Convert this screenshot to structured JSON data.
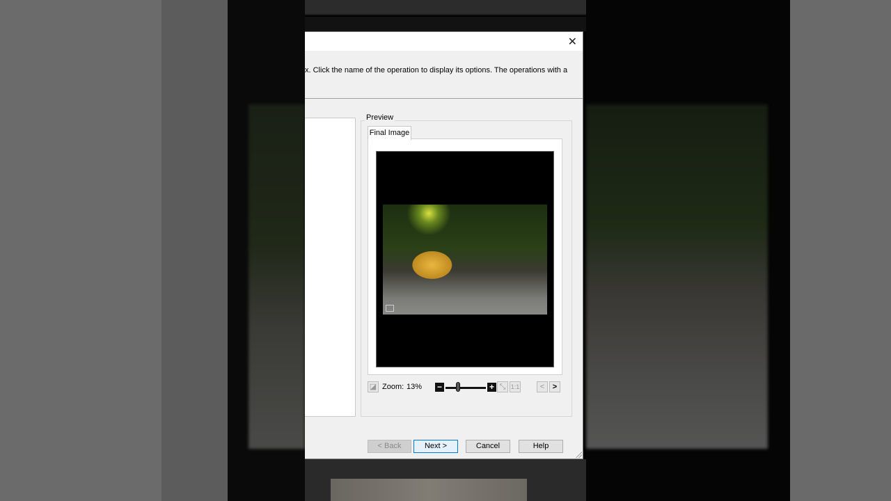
{
  "dialog": {
    "instruction": "x.  Click the name of the operation to display its options.  The operations with a",
    "close_icon": "close-icon",
    "preview_label": "Preview",
    "tab_label": "Final Image",
    "zoom_label": "Zoom:",
    "zoom_value": "13%",
    "zoom_level_percent": 13,
    "one_to_one_label": "1:1",
    "prev_label": "<",
    "next_arrow_label": ">",
    "buttons": {
      "back": "< Back",
      "next": "Next >",
      "cancel": "Cancel",
      "help": "Help"
    },
    "accent": "#0078d7"
  }
}
